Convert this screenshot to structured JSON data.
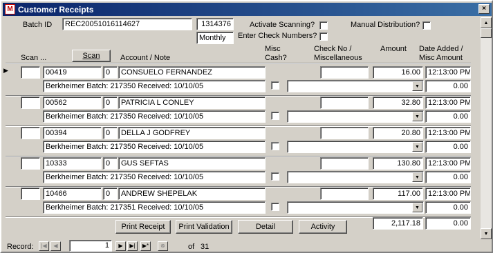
{
  "window": {
    "title": "Customer Receipts",
    "close": "×"
  },
  "header": {
    "batch_id_label": "Batch ID",
    "batch_id_value": "REC20051016114627",
    "batch_number": "1314376",
    "frequency": "Monthly",
    "activate_scanning_label": "Activate Scanning?",
    "enter_check_numbers_label": "Enter Check Numbers?",
    "manual_distribution_label": "Manual Distribution?"
  },
  "columns": {
    "scan": "Scan ...",
    "scan_button": "Scan",
    "account_note": "Account / Note",
    "misc_cash": "Misc Cash?",
    "check_no": "Check No / Miscellaneous",
    "amount": "Amount",
    "date_added": "Date Added / Misc Amount"
  },
  "rows": [
    {
      "account": "00419",
      "seq": "0",
      "name": "CONSUELO FERNANDEZ",
      "note": "Berkheimer Batch: 217350 Received: 10/10/05",
      "check_no": "",
      "misc": "",
      "amount": "16.00",
      "time": "12:13:00 PM",
      "misc_amount": "0.00",
      "current": true
    },
    {
      "account": "00562",
      "seq": "0",
      "name": "PATRICIA L CONLEY",
      "note": "Berkheimer Batch: 217350 Received: 10/10/05",
      "check_no": "",
      "misc": "",
      "amount": "32.80",
      "time": "12:13:00 PM",
      "misc_amount": "0.00",
      "current": false
    },
    {
      "account": "00394",
      "seq": "0",
      "name": "DELLA J GODFREY",
      "note": "Berkheimer Batch: 217350 Received: 10/10/05",
      "check_no": "",
      "misc": "",
      "amount": "20.80",
      "time": "12:13:00 PM",
      "misc_amount": "0.00",
      "current": false
    },
    {
      "account": "10333",
      "seq": "0",
      "name": "GUS SEFTAS",
      "note": "Berkheimer Batch: 217350 Received: 10/10/05",
      "check_no": "",
      "misc": "",
      "amount": "130.80",
      "time": "12:13:00 PM",
      "misc_amount": "0.00",
      "current": false
    },
    {
      "account": "10466",
      "seq": "0",
      "name": "ANDREW SHEPELAK",
      "note": "Berkheimer Batch: 217351 Received: 10/10/05",
      "check_no": "",
      "misc": "",
      "amount": "117.00",
      "time": "12:13:00 PM",
      "misc_amount": "0.00",
      "current": false
    }
  ],
  "footer": {
    "print_receipt": "Print Receipt",
    "print_validation": "Print Validation",
    "detail": "Detail",
    "activity": "Activity",
    "total_amount": "2,117.18",
    "total_misc": "0.00"
  },
  "navigation": {
    "record_label": "Record:",
    "current_record": "1",
    "of_label": "of",
    "total_records": "31"
  }
}
